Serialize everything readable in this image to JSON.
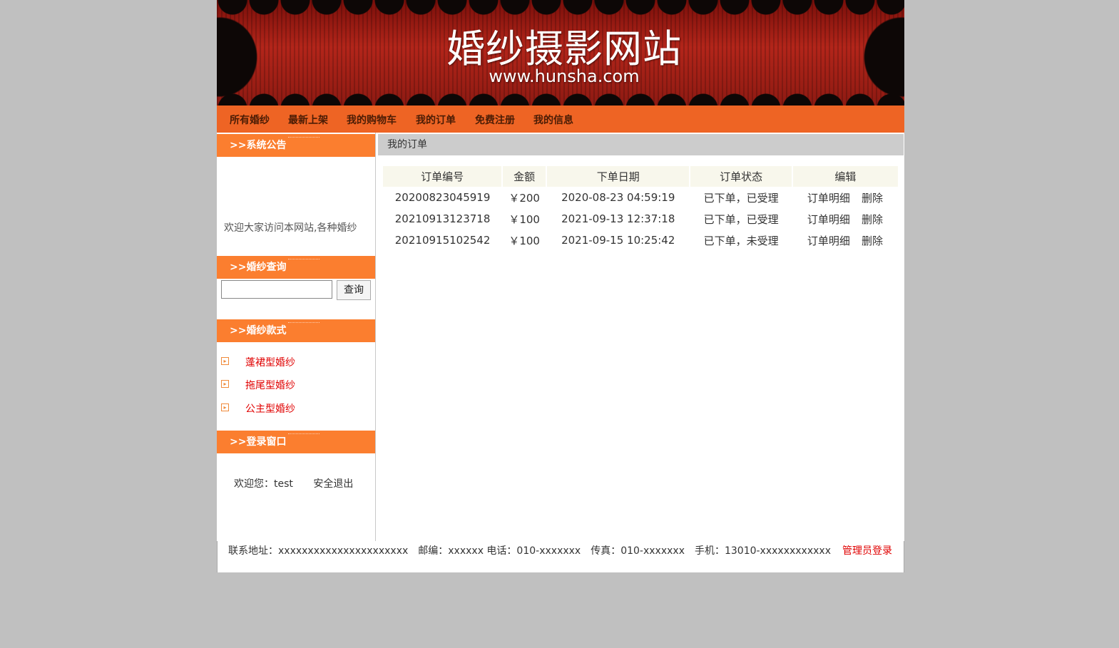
{
  "banner": {
    "title": "婚纱摄影网站",
    "url": "www.hunsha.com"
  },
  "nav": {
    "items": [
      "所有婚纱",
      "最新上架",
      "我的购物车",
      "我的订单",
      "免费注册",
      "我的信息"
    ]
  },
  "sidebar": {
    "notice_header": ">>系统公告",
    "notice_text": "欢迎大家访问本网站,各种婚纱",
    "search_header": ">>婚纱查询",
    "search_value": "",
    "search_button": "查询",
    "styles_header": ">>婚纱款式",
    "styles": [
      "蓬裙型婚纱",
      "拖尾型婚纱",
      "公主型婚纱"
    ],
    "login_header": ">>登录窗口",
    "welcome": "欢迎您：test",
    "logout": "安全退出"
  },
  "main": {
    "title": "我的订单",
    "columns": [
      "订单编号",
      "金额",
      "下单日期",
      "订单状态",
      "编辑"
    ],
    "rows": [
      {
        "id": "20200823045919",
        "amount": "￥200",
        "date": "2020-08-23 04:59:19",
        "status": "已下单，已受理",
        "detail": "订单明细",
        "delete": "删除"
      },
      {
        "id": "20210913123718",
        "amount": "￥100",
        "date": "2021-09-13 12:37:18",
        "status": "已下单，已受理",
        "detail": "订单明细",
        "delete": "删除"
      },
      {
        "id": "20210915102542",
        "amount": "￥100",
        "date": "2021-09-15 10:25:42",
        "status": "已下单，未受理",
        "detail": "订单明细",
        "delete": "删除"
      }
    ]
  },
  "footer": {
    "info": "联系地址：xxxxxxxxxxxxxxxxxxxxxx　邮编：xxxxxx 电话：010-xxxxxxx　传真：010-xxxxxxx　手机：13010-xxxxxxxxxxxx",
    "admin_login": "管理员登录"
  }
}
